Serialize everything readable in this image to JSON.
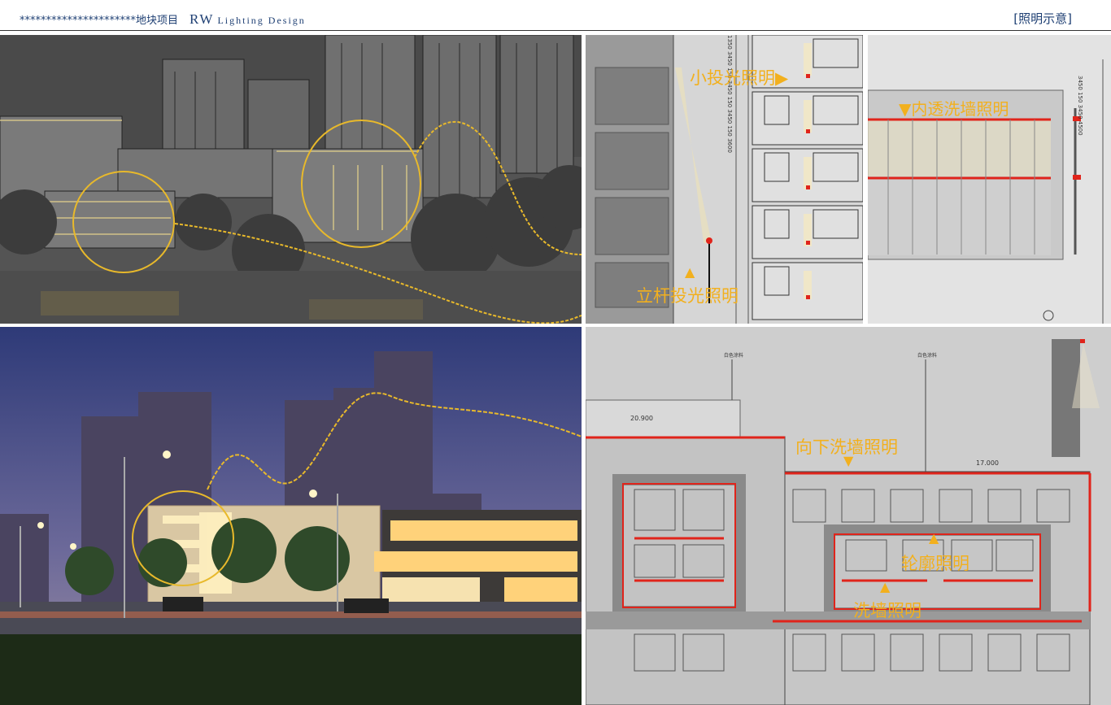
{
  "header": {
    "project": "**********************地块项目",
    "brand": "RW",
    "brand_sub": "Lighting Design",
    "page_tag": "[照明示意]"
  },
  "labels": {
    "small_flood": "小投光照明▶",
    "pole_flood": "立杆投光照明",
    "inner_wash": "▼内透洗墙照明",
    "down_wash": "向下洗墙照明",
    "outline": "轮廓照明",
    "wash": "洗墙照明"
  },
  "dimensions": {
    "elev_left": [
      "1350",
      "3450",
      "150",
      "3450",
      "150",
      "3450",
      "150",
      "3600"
    ],
    "elev_right": [
      "3450",
      "150",
      "3450",
      "4500"
    ],
    "level_1": "20.900",
    "level_2": "17.000",
    "note_1": "白色涂料",
    "note_2": "白色涂料"
  },
  "colors": {
    "accent": "#f2b01e",
    "fixture_red": "#e0241b",
    "header_text": "#1e3f73"
  }
}
